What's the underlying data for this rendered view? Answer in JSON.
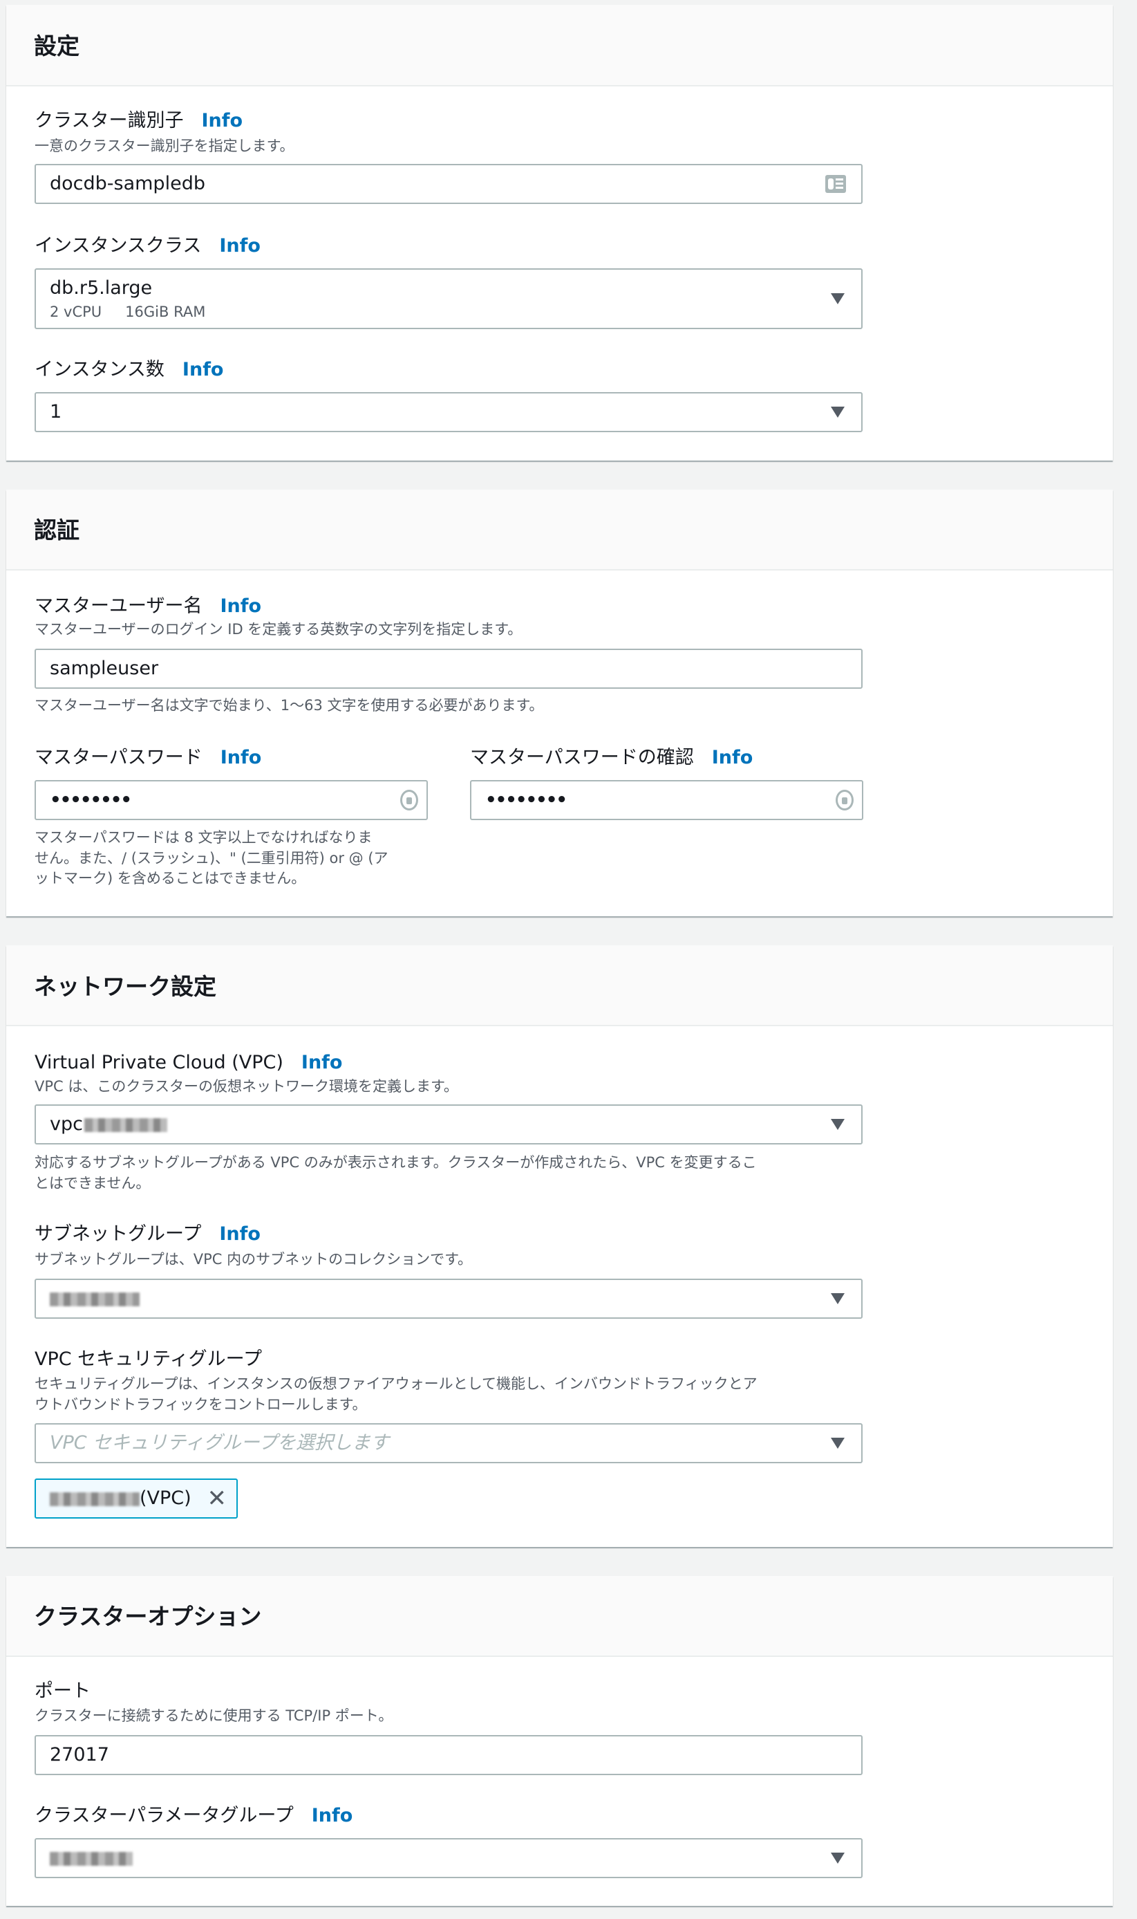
{
  "settings": {
    "title": "設定",
    "cluster_id": {
      "label": "クラスター識別子",
      "info": "Info",
      "desc": "一意のクラスター識別子を指定します。",
      "value": "docdb-sampledb"
    },
    "instance_class": {
      "label": "インスタンスクラス",
      "info": "Info",
      "value": "db.r5.large",
      "vcpu": "2 vCPU",
      "ram": "16GiB RAM"
    },
    "instance_count": {
      "label": "インスタンス数",
      "info": "Info",
      "value": "1"
    }
  },
  "auth": {
    "title": "認証",
    "username": {
      "label": "マスターユーザー名",
      "info": "Info",
      "desc": "マスターユーザーのログイン ID を定義する英数字の文字列を指定します。",
      "value": "sampleuser",
      "hint": "マスターユーザー名は文字で始まり、1〜63 文字を使用する必要があります。"
    },
    "password": {
      "label": "マスターパスワード",
      "info": "Info",
      "value": "••••••••",
      "hint1": "マスターパスワードは 8 文字以上でなければなりま",
      "hint2": "せん。また、/ (スラッシュ)、\" (二重引用符) or @ (ア",
      "hint3": "ットマーク) を含めることはできません。"
    },
    "confirm": {
      "label": "マスターパスワードの確認",
      "info": "Info",
      "value": "••••••••"
    }
  },
  "network": {
    "title": "ネットワーク設定",
    "vpc": {
      "label": "Virtual Private Cloud (VPC)",
      "info": "Info",
      "desc": "VPC は、このクラスターの仮想ネットワーク環境を定義します。",
      "value_prefix": "vpc",
      "hint1": "対応するサブネットグループがある VPC のみが表示されます。クラスターが作成されたら、VPC を変更するこ",
      "hint2": "とはできません。"
    },
    "subnet": {
      "label": "サブネットグループ",
      "info": "Info",
      "desc": "サブネットグループは、VPC 内のサブネットのコレクションです。"
    },
    "sg": {
      "label": "VPC セキュリティグループ",
      "desc1": "セキュリティグループは、インスタンスの仮想ファイアウォールとして機能し、インバウンドトラフィックとア",
      "desc2": "ウトバウンドトラフィックをコントロールします。",
      "placeholder": "VPC セキュリティグループを選択します",
      "token_suffix": "(VPC)"
    }
  },
  "options": {
    "title": "クラスターオプション",
    "port": {
      "label": "ポート",
      "desc": "クラスターに接続するために使用する TCP/IP ポート。",
      "value": "27017"
    },
    "param_group": {
      "label": "クラスターパラメータグループ",
      "info": "Info"
    }
  }
}
